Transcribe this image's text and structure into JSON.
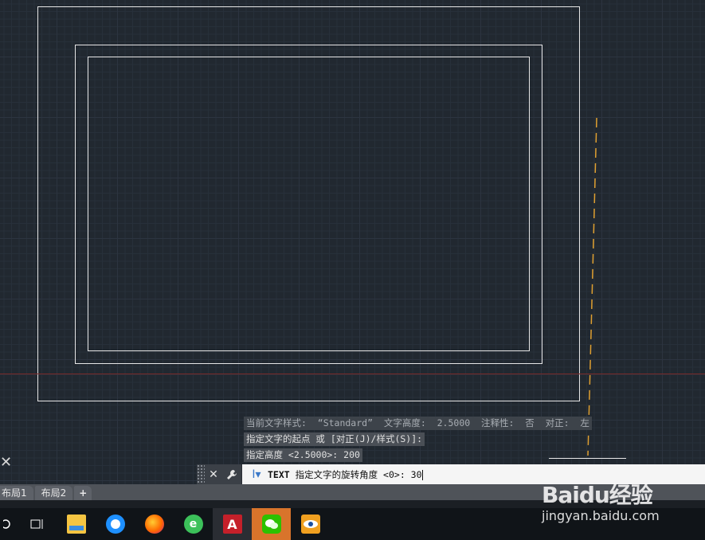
{
  "history": {
    "line1": "当前文字样式:  “Standard”  文字高度:  2.5000  注释性:  否  对正:  左",
    "line2": "指定文字的起点 或 [对正(J)/样式(S)]:",
    "line3": "指定高度 <2.5000>: 200"
  },
  "command": {
    "name": "TEXT",
    "prompt": " 指定文字的旋转角度 <0>: ",
    "value": "30",
    "close_icon": "close-icon",
    "customize_icon": "wrench-icon"
  },
  "layout_tabs": [
    "布局1",
    "布局2"
  ],
  "add_tab_label": "+",
  "canvas_close": "✕",
  "taskbar": {
    "apps": [
      "task-view-icon",
      "file-explorer-icon",
      "qq-browser-icon",
      "firefox-icon",
      "360-browser-icon",
      "autocad-icon",
      "wechat-icon",
      "image-viewer-icon"
    ],
    "autocad_letter": "A"
  },
  "watermark": {
    "logo": "Baidu经验",
    "url": "jingyan.baidu.com"
  },
  "colors": {
    "canvas_bg": "#212830",
    "accent_active": "#d9742b",
    "dashed_line": "#e0a030"
  }
}
